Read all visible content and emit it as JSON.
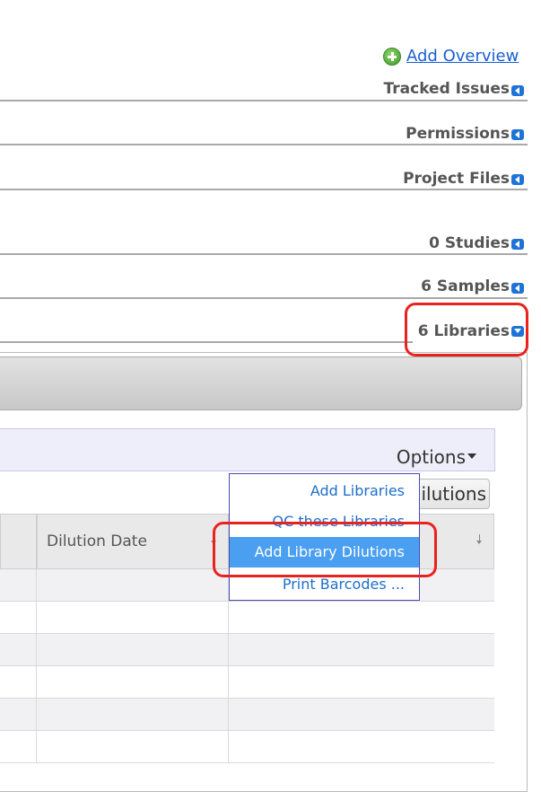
{
  "overview": {
    "add_label": "Add Overview"
  },
  "sections": {
    "tracked_issues": "Tracked Issues",
    "permissions": "Permissions",
    "project_files": "Project Files",
    "studies": "0 Studies",
    "samples": "6 Samples",
    "libraries": "6 Libraries"
  },
  "libraries_panel": {
    "options_label": "Options",
    "hidden_button_label": "ilutions",
    "table": {
      "columns": [
        "",
        "Dilution Date",
        ""
      ],
      "row_count": 6
    }
  },
  "options_menu": {
    "items": [
      "Add Libraries",
      "QC these Libraries",
      "Add Library Dilutions",
      "Print Barcodes ..."
    ],
    "active_item": "Add Library Dilutions"
  },
  "colors": {
    "link": "#1a5fd0",
    "highlight": "#e8231f",
    "menu_active": "#4a9ff0",
    "section_arrow": "#1d73d6"
  },
  "icons": [
    "add-circle-icon",
    "collapse-left-icon",
    "expand-down-icon",
    "sort-icon",
    "caret-down-icon"
  ]
}
